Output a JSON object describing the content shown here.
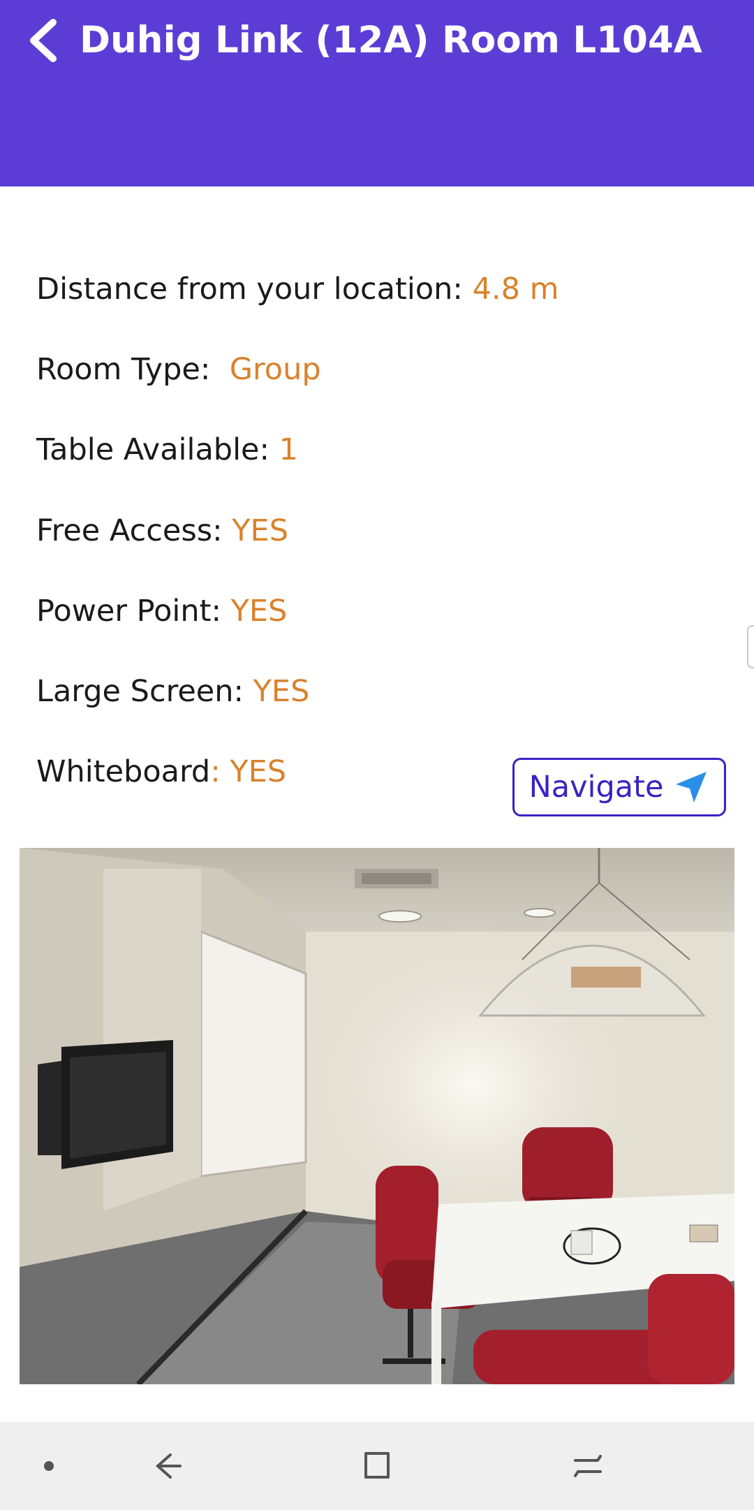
{
  "header": {
    "title": "Duhig Link (12A) Room L104A",
    "back_icon": "chevron-left-icon"
  },
  "details": [
    {
      "label": "Distance from your location: ",
      "value": "4.8 m"
    },
    {
      "label": "Room Type:  ",
      "value": "Group"
    },
    {
      "label": "Table Available: ",
      "value": "1"
    },
    {
      "label": "Free Access: ",
      "value": "YES"
    },
    {
      "label": "Power Point: ",
      "value": "YES"
    },
    {
      "label": "Large Screen: ",
      "value": "YES"
    },
    {
      "label": "Whiteboard",
      "value": ": YES"
    }
  ],
  "navigate": {
    "label": "Navigate",
    "icon": "navigation-arrow-icon"
  },
  "photo": {
    "subject": "room-photo"
  },
  "navbar": {
    "icons": [
      "dot-icon",
      "back-arrow-icon",
      "home-square-icon",
      "recents-icon"
    ]
  },
  "colors": {
    "header_bg": "#5b3dd6",
    "value_text": "#d9822b",
    "button_accent": "#3a22c4",
    "nav_icon": "#2a8ee8"
  }
}
